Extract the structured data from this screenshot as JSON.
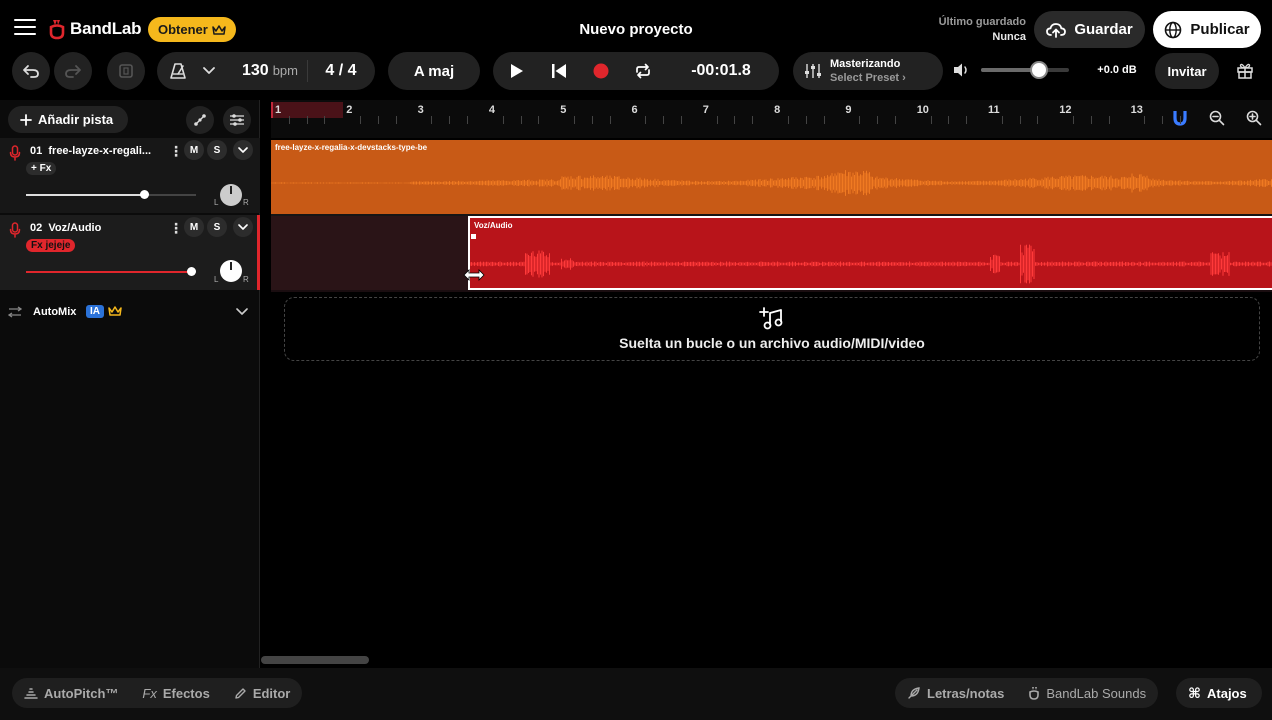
{
  "app": {
    "brand": "BandLab",
    "get_label": "Obtener",
    "project_title": "Nuevo proyecto",
    "last_saved_label": "Último guardado",
    "last_saved_value": "Nunca",
    "save_label": "Guardar",
    "publish_label": "Publicar"
  },
  "transport": {
    "bpm": "130",
    "bpm_unit": "bpm",
    "time_signature": "4 / 4",
    "key": "A maj",
    "time_display": "-00:01.8",
    "mastering_title": "Masterizando",
    "mastering_preset": "Select Preset ›",
    "master_volume_level": 0.7,
    "master_db": "+0.0 dB",
    "invite_label": "Invitar"
  },
  "left_panel": {
    "add_track_label": "Añadir pista",
    "tracks": [
      {
        "number": "01",
        "name": "free-layze-x-regali...",
        "fx_label": "+ Fx",
        "mute_label": "M",
        "solo_label": "S",
        "volume_level": 0.71,
        "pan_l": "L",
        "pan_r": "R"
      },
      {
        "number": "02",
        "name": "Voz/Audio",
        "fx_label": "Fx jejeje",
        "mute_label": "M",
        "solo_label": "S",
        "volume_level": 1.0,
        "pan_l": "L",
        "pan_r": "R"
      }
    ],
    "automix_label": "AutoMix",
    "automix_badge": "IA"
  },
  "timeline": {
    "bars": [
      "1",
      "2",
      "3",
      "4",
      "5",
      "6",
      "7",
      "8",
      "9",
      "10",
      "11",
      "12",
      "13"
    ],
    "clips": [
      {
        "name": "free-layze-x-regalia-x-devstacks-type-be",
        "color": "#c85a16"
      },
      {
        "name": "Voz/Audio",
        "color": "#b8141a"
      }
    ],
    "dropzone_text": "Suelta un bucle o un archivo audio/MIDI/video"
  },
  "bottom_bar": {
    "autopitch_label": "AutoPitch™",
    "effects_prefix": "Fx",
    "effects_label": "Efectos",
    "editor_label": "Editor",
    "lyrics_label": "Letras/notas",
    "sounds_label": "BandLab Sounds",
    "shortcuts_label": "Atajos"
  },
  "colors": {
    "accent_red": "#e0262c",
    "brand_yellow": "#f5b81c",
    "orange_clip": "#c85a16",
    "magnet_blue": "#3a7bff"
  }
}
